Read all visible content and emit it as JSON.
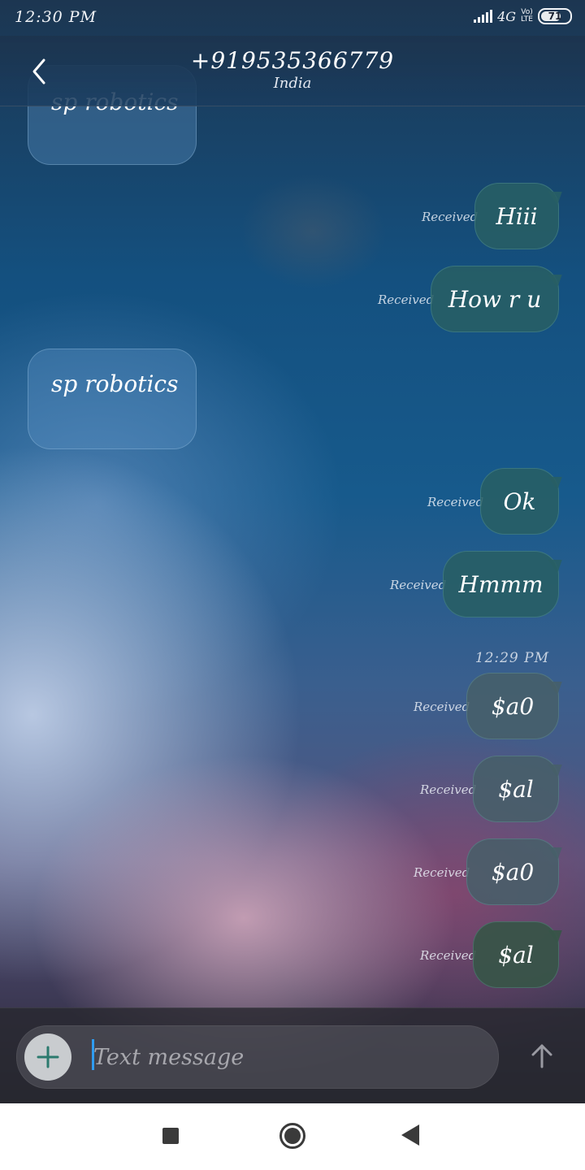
{
  "status_bar": {
    "time": "12:30 PM",
    "network": "4G",
    "volte_top": "Vo)",
    "volte_bottom": "LTE",
    "battery": "71"
  },
  "header": {
    "title": "+919535366779",
    "subtitle": "India",
    "back_icon": "chevron-left-icon"
  },
  "conversation": {
    "partial_message": "sp robotics",
    "messages": [
      {
        "direction": "outgoing",
        "text": "Hiii",
        "status": "Received"
      },
      {
        "direction": "outgoing",
        "text": "How r u",
        "status": "Received"
      },
      {
        "direction": "incoming",
        "text": "sp robotics"
      },
      {
        "direction": "outgoing",
        "text": "Ok",
        "status": "Received"
      },
      {
        "direction": "outgoing",
        "text": "Hmmm",
        "status": "Received"
      },
      {
        "direction": "outgoing",
        "text": "$a0",
        "status": "Received"
      },
      {
        "direction": "outgoing",
        "text": "$al",
        "status": "Received"
      },
      {
        "direction": "outgoing",
        "text": "$a0",
        "status": "Received"
      },
      {
        "direction": "outgoing",
        "text": "$al",
        "status": "Received"
      }
    ],
    "timestamp": "12:29 PM"
  },
  "composer": {
    "placeholder": "Text message",
    "value": "",
    "attach_icon": "plus-icon",
    "send_icon": "arrow-up-icon"
  },
  "nav_bar": {
    "icons": [
      "recents-square-icon",
      "home-circle-icon",
      "back-triangle-icon"
    ]
  },
  "colors": {
    "outgoing_bubble": "#285F64",
    "incoming_bubble": "#5F96C8",
    "cursor": "#2F9CF0"
  }
}
